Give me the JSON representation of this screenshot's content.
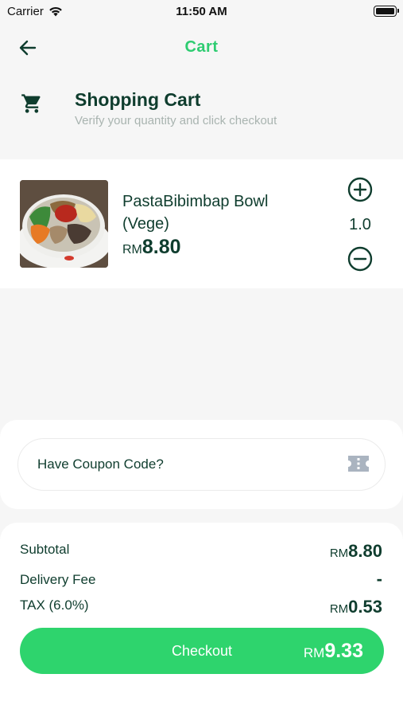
{
  "status_bar": {
    "carrier": "Carrier",
    "time": "11:50 AM"
  },
  "nav": {
    "title": "Cart"
  },
  "header": {
    "title": "Shopping Cart",
    "subtitle": "Verify your quantity and click checkout"
  },
  "items": [
    {
      "name": "PastaBibimbap Bowl (Vege)",
      "currency": "RM",
      "price": "8.80",
      "quantity": "1.0"
    }
  ],
  "coupon": {
    "placeholder": "Have Coupon Code?"
  },
  "summary": {
    "subtotal_label": "Subtotal",
    "subtotal_currency": "RM",
    "subtotal_value": "8.80",
    "delivery_label": "Delivery Fee",
    "delivery_value": "-",
    "tax_label": "TAX (6.0%)",
    "tax_currency": "RM",
    "tax_value": "0.53"
  },
  "checkout": {
    "label": "Checkout",
    "currency": "RM",
    "total": "9.33"
  },
  "colors": {
    "accent": "#2ed46d",
    "title_green": "#2ecc71",
    "text_dark": "#0f3d2e",
    "subtitle_gray": "#a9b4b0",
    "background": "#f6f6f6"
  },
  "icons": {
    "back": "arrow-left-icon",
    "cart": "shopping-cart-icon",
    "plus": "plus-circle-icon",
    "minus": "minus-circle-icon",
    "coupon": "ticket-icon",
    "wifi": "wifi-icon",
    "battery": "battery-icon"
  }
}
